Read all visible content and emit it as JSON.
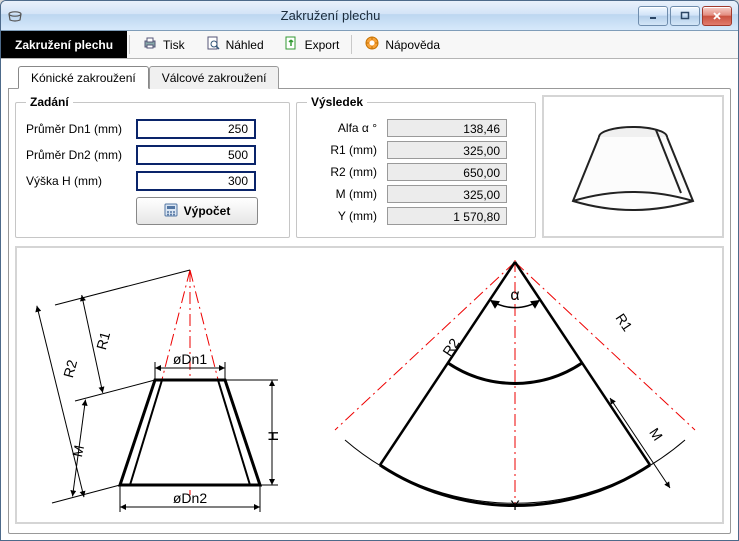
{
  "window": {
    "title": "Zakružení plechu"
  },
  "toolbar": {
    "main_label": "Zakružení plechu",
    "print": "Tisk",
    "preview": "Náhled",
    "export": "Export",
    "help": "Nápověda"
  },
  "tabs": {
    "conical": "Kónické zakroužení",
    "cylindrical": "Válcové zakroužení"
  },
  "group_input": {
    "legend": "Zadání",
    "dn1_label": "Průměr Dn1 (mm)",
    "dn1_value": "250",
    "dn2_label": "Průměr Dn2 (mm)",
    "dn2_value": "500",
    "h_label": "Výška H (mm)",
    "h_value": "300",
    "calc_label": "Výpočet"
  },
  "group_output": {
    "legend": "Výsledek",
    "alfa_label": "Alfa α °",
    "alfa_value": "138,46",
    "r1_label": "R1 (mm)",
    "r1_value": "325,00",
    "r2_label": "R2 (mm)",
    "r2_value": "650,00",
    "m_label": "M (mm)",
    "m_value": "325,00",
    "y_label": "Y (mm)",
    "y_value": "1 570,80"
  },
  "diagram_labels": {
    "r1": "R1",
    "r2": "R2",
    "m": "M",
    "h": "H",
    "dn1": "øDn1",
    "dn2": "øDn2",
    "alpha": "α",
    "y": "Y"
  }
}
